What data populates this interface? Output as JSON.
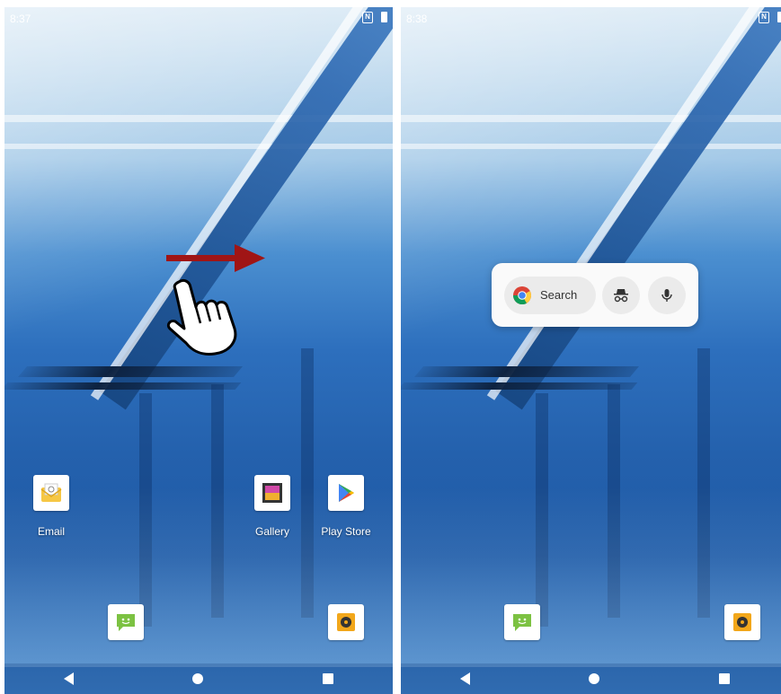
{
  "left_screen": {
    "status_bar": {
      "time": "8:37"
    },
    "apps": [
      {
        "label": "Email",
        "icon": "email-icon"
      },
      {
        "label": "Gallery",
        "icon": "gallery-icon"
      },
      {
        "label": "Play Store",
        "icon": "play-store-icon"
      }
    ],
    "dock": [
      {
        "icon": "messaging-icon"
      },
      {
        "icon": "music-icon"
      }
    ],
    "gesture": {
      "arrow": "swipe-right-arrow",
      "hand": "pointing-hand",
      "arrow_color": "#a01515"
    }
  },
  "right_screen": {
    "status_bar": {
      "time": "8:38"
    },
    "search_widget": {
      "search_label": "Search",
      "buttons": [
        "chrome-icon",
        "incognito-icon",
        "microphone-icon"
      ]
    },
    "dock": [
      {
        "icon": "messaging-icon"
      },
      {
        "icon": "music-icon"
      }
    ]
  },
  "colors": {
    "wallpaper_dark": "#1f5aa6",
    "wallpaper_light": "#cfe3f2",
    "widget_bg": "#fafafa"
  }
}
